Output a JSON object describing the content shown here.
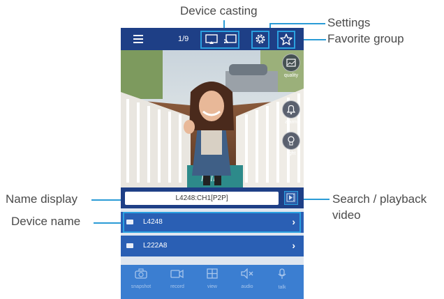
{
  "annotations": {
    "device_casting": "Device casting",
    "settings": "Settings",
    "favorite_group": "Favorite group",
    "name_display": "Name display",
    "search_playback_line1": "Search / playback",
    "search_playback_line2": "video",
    "device_name": "Device name"
  },
  "topbar": {
    "page_counter": "1/9"
  },
  "video": {
    "quality_label": "quality",
    "alarm_label": "alarm",
    "light_label": "light",
    "mat_text": "hello"
  },
  "name_display": {
    "value": "L4248:CH1[P2P]"
  },
  "devices": [
    {
      "name": "L4248"
    },
    {
      "name": "L222A8"
    }
  ],
  "toolbar": {
    "snapshot": "snapshot",
    "record": "record",
    "view": "view",
    "audio": "audio",
    "talk": "talk"
  },
  "colors": {
    "top_bar": "#1e3f86",
    "device_row": "#2a5fb4",
    "toolbar": "#3b7ed1",
    "annotation_line": "#2a9bd6"
  }
}
